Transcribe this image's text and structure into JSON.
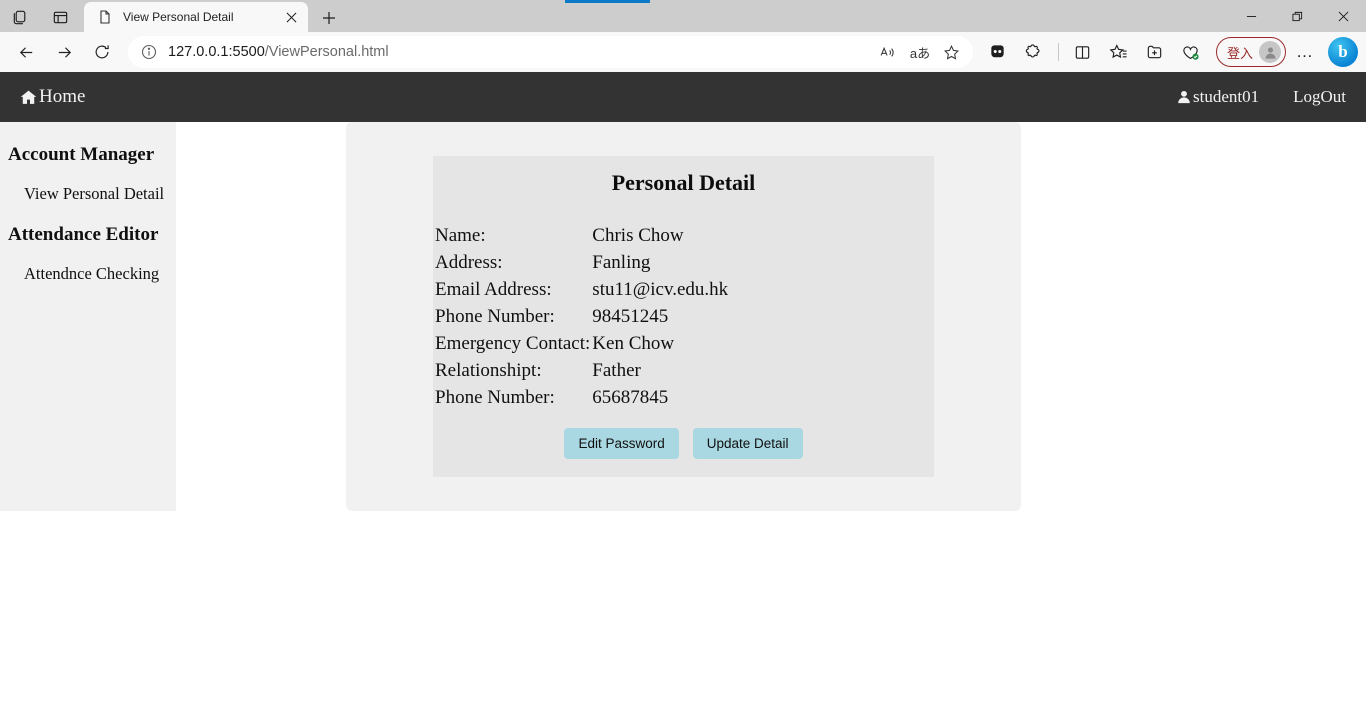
{
  "browser": {
    "tab": {
      "title": "View Personal Detail",
      "favicon": "page-icon",
      "close": "×"
    },
    "new_tab_label": "+",
    "window_controls": {
      "minimize": "minimize-icon",
      "restore": "restore-icon",
      "close": "close-icon"
    },
    "toolbar": {
      "back": "back-arrow-icon",
      "forward": "forward-arrow-icon",
      "reload": "reload-icon",
      "info": "info-icon",
      "url_host": "127.0.0.1:5500",
      "url_path": "/ViewPersonal.html",
      "url_full": "127.0.0.1:5500/ViewPersonal.html",
      "read_aloud": "A",
      "translate": "aあ",
      "favorite": "☆",
      "icons": [
        "collections-icon",
        "extensions-icon",
        "split-screen-icon",
        "favorites-icon",
        "add-collection-icon",
        "browser-essentials-icon"
      ],
      "signin_label": "登入",
      "settings_more": "…",
      "copilot": "b"
    }
  },
  "navbar": {
    "brand": "Home",
    "brand_icon": "home-icon",
    "user": "student01",
    "user_icon": "user-icon",
    "logout": "LogOut"
  },
  "sidebar": {
    "groups": [
      {
        "heading": "Account Manager",
        "link": "View Personal Detail"
      },
      {
        "heading": "Attendance Editor",
        "link": "Attendnce Checking"
      }
    ]
  },
  "card": {
    "title": "Personal Detail",
    "rows": [
      {
        "label": "Name:",
        "value": "Chris Chow"
      },
      {
        "label": "Address:",
        "value": "Fanling"
      },
      {
        "label": "Email Address:",
        "value": "stu11@icv.edu.hk"
      },
      {
        "label": "Phone Number:",
        "value": "98451245"
      },
      {
        "label": "Emergency Contact:",
        "value": "Ken Chow"
      },
      {
        "label": "Relationshipt:",
        "value": "Father"
      },
      {
        "label": "Phone Number:",
        "value": "65687845"
      }
    ],
    "buttons": {
      "edit_password": "Edit Password",
      "update_detail": "Update Detail"
    }
  },
  "colors": {
    "navbar_bg": "#333333",
    "panel_bg": "#f1f1f1",
    "card_bg": "#e5e5e5",
    "button_bg": "#a9d8e2",
    "accent_line": "#0a7ac8",
    "signin_border": "#9b2b2b"
  }
}
